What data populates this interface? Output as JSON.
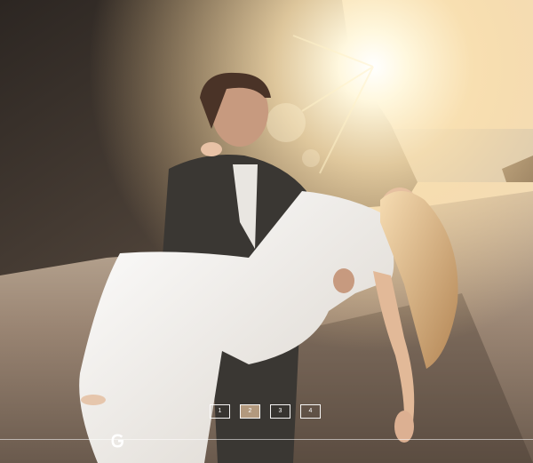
{
  "gallery": {
    "pages": [
      {
        "label": "1",
        "active": false
      },
      {
        "label": "2",
        "active": true
      },
      {
        "label": "3",
        "active": false
      },
      {
        "label": "4",
        "active": false
      }
    ],
    "current_page": 2,
    "total_pages": 4
  },
  "logo": {
    "icon": "g-logo-icon"
  },
  "colors": {
    "sun": "#fff6d8",
    "sky": "#fbe7c4",
    "sea": "#c9c2b6",
    "sand": "#8e7b6a",
    "rock": "#3b332d",
    "suit": "#3a3733",
    "dress": "#f1efea",
    "hair": "#e8c59a"
  }
}
